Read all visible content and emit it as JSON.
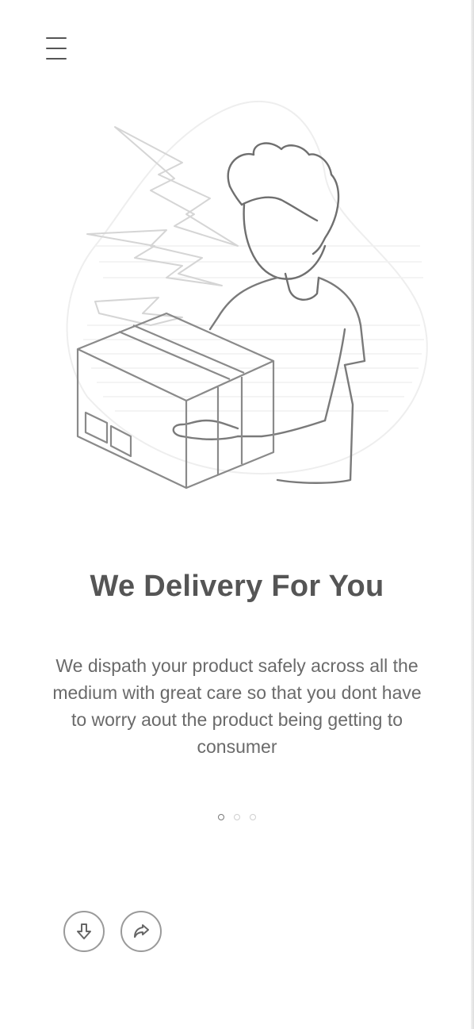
{
  "header": {
    "menu_icon": "hamburger-menu-icon"
  },
  "hero": {
    "illustration": "delivery-person-holding-box"
  },
  "content": {
    "title": "We Delivery For You",
    "description": "We dispath your product safely across all the medium with great care so that you dont have to worry aout the product being getting to consumer"
  },
  "pager": {
    "total": 3,
    "active_index": 0
  },
  "actions": {
    "download_icon": "download-arrow-icon",
    "share_icon": "share-arrow-icon"
  },
  "colors": {
    "text": "#555555",
    "line": "#9a9a9a"
  }
}
